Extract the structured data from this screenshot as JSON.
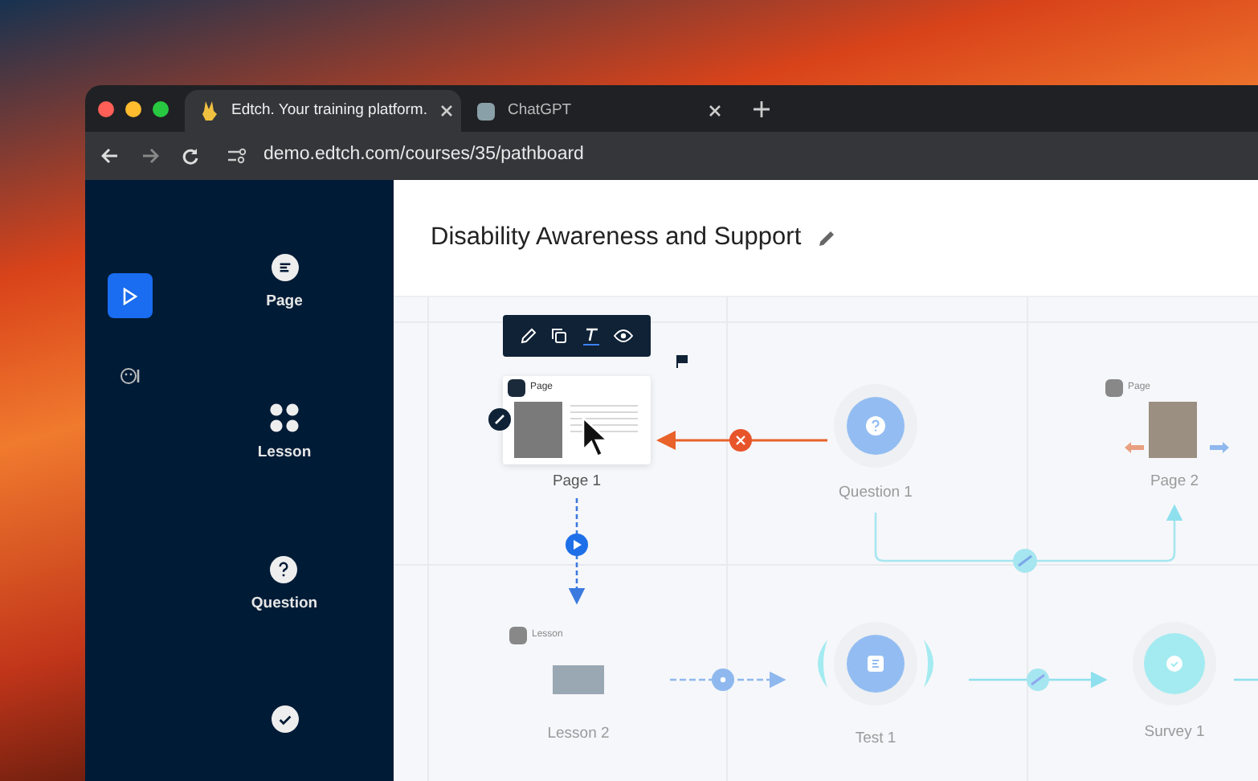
{
  "browser": {
    "tabs": [
      {
        "title": "Edtch. Your training platform.",
        "selected": true
      },
      {
        "title": "ChatGPT",
        "selected": false
      }
    ],
    "url": "demo.edtch.com/courses/35/pathboard"
  },
  "rail": [
    {
      "kind": "play",
      "selected": true
    },
    {
      "kind": "emoji",
      "selected": false
    }
  ],
  "palette": [
    {
      "kind": "page",
      "label": "Page"
    },
    {
      "kind": "lesson",
      "label": "Lesson"
    },
    {
      "kind": "question",
      "label": "Question"
    },
    {
      "kind": "survey"
    }
  ],
  "title": "Disability Awareness and Support",
  "nodes": [
    {
      "kind": "page",
      "badge": "Page",
      "label": "Page 1",
      "selected": true
    },
    {
      "kind": "question",
      "label": "Question 1",
      "selected": false
    },
    {
      "kind": "page",
      "badge": "Page",
      "label": "Page 2",
      "selected": false
    },
    {
      "kind": "lesson",
      "badge": "Lesson",
      "label": "Lesson 2",
      "selected": false
    },
    {
      "kind": "test",
      "label": "Test 1",
      "selected": false
    },
    {
      "kind": "survey",
      "label": "Survey 1",
      "selected": false
    }
  ]
}
